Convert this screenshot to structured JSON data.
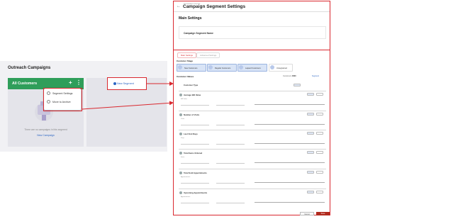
{
  "left": {
    "title": "Outreach Campaigns",
    "card": {
      "title": "All Customers",
      "plus": "+",
      "dots": "⋮",
      "empty_text": "There are no campaigns in this segment",
      "new_campaign": "New Campaign"
    },
    "menu": {
      "items": [
        "Segment Settings",
        "Move to Archive"
      ]
    },
    "new_segment": "New Segment"
  },
  "right": {
    "breadcrumb": "Campaign Center",
    "back": "←",
    "title": "Campaign Segment Settings",
    "main_settings": "Main Settings",
    "segment_name_label": "Campaign Segment Name",
    "tabs": [
      "Main Settings",
      "Advanced Settings"
    ],
    "customer_stage_label": "Customer Stage",
    "stages": [
      "New Customers",
      "Regular Customers",
      "Lapsed Customers",
      "Unregistered"
    ],
    "customer_values_label": "Customer Values",
    "values_meta": {
      "count_label": "Customers",
      "count": "0000",
      "segment_label": "Segment"
    },
    "filters": [
      {
        "name": "Average Bill Value",
        "sub": "Bill Value"
      },
      {
        "name": "Number of Visits",
        "sub": "Visits"
      },
      {
        "name": "Last Visit Days",
        "sub": "Days"
      },
      {
        "name": "Total Items Ordered",
        "sub": "Items"
      },
      {
        "name": "Total Sold Appointments",
        "sub": "Appointments"
      },
      {
        "name": "Upcoming Appointments",
        "sub": "Appointments"
      }
    ],
    "customer_type_label": "Customer Type",
    "cancel": "Cancel",
    "save": "Save"
  },
  "colors": {
    "accent_green": "#2f9e5a",
    "highlight_red": "#d9282f",
    "link_blue": "#2b66c4",
    "save_red": "#b02a1e"
  }
}
